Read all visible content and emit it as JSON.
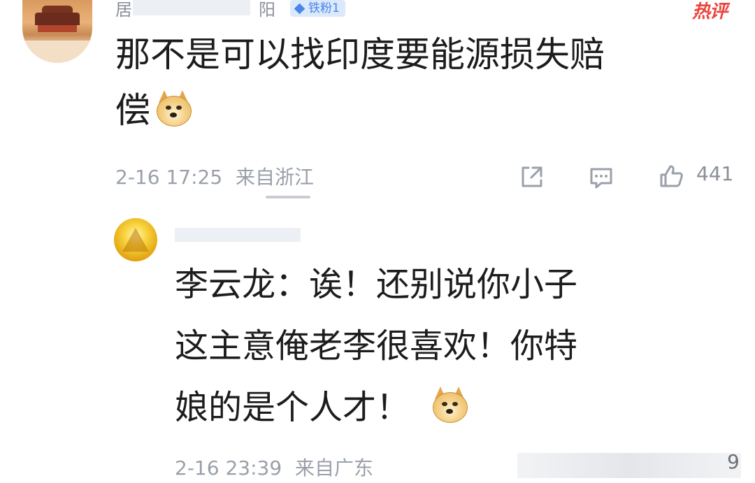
{
  "comment1": {
    "username_start": "居",
    "username_end": "阳",
    "badge": "铁粉1",
    "hot_tag": "热评",
    "text_line1": "那不是可以找印度要能源损失赔",
    "text_line2": "偿",
    "emoji": "doge-icon",
    "time": "2-16 17:25",
    "location": "来自浙江",
    "like_count": "441"
  },
  "comment2": {
    "text_line1": "李云龙：诶！还别说你小子",
    "text_line2": "这主意俺老李很喜欢！你特",
    "text_line3": "娘的是个人才！",
    "emoji": "doge-icon",
    "time": "2-16 23:39",
    "location": "来自广东",
    "like_count_partial": "9"
  },
  "colors": {
    "badge_bg": "#dbe9fb",
    "badge_text": "#4a86e8",
    "hot": "#e9453c",
    "meta": "#9aa0aa"
  }
}
